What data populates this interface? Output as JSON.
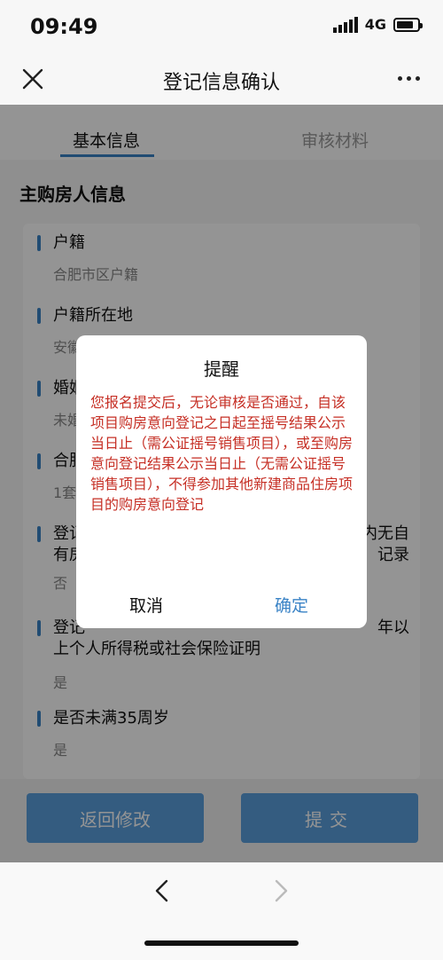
{
  "status_bar": {
    "time": "09:49",
    "network": "4G"
  },
  "header": {
    "title": "登记信息确认"
  },
  "tabs": [
    {
      "label": "基本信息",
      "active": true
    },
    {
      "label": "审核材料",
      "active": false
    }
  ],
  "section": {
    "title": "主购房人信息"
  },
  "fields": [
    {
      "label": "户籍",
      "value": "合肥市区户籍"
    },
    {
      "label": "户籍所在地",
      "value": "安徽"
    },
    {
      "label": "婚姻",
      "value": "未婚"
    },
    {
      "label": "合肥",
      "value": "1套"
    },
    {
      "label": "登记",
      "label_right": "内无自",
      "label_line2": "有房",
      "label_line2_right": "记录",
      "value": "否"
    },
    {
      "label": "登记",
      "label_right": "年以",
      "label_line2": "上个人所得税或社会保险证明",
      "value": "是"
    },
    {
      "label": "是否未满35周岁",
      "value": "是"
    }
  ],
  "buttons": {
    "back": "返回修改",
    "submit": "提交"
  },
  "dialog": {
    "title": "提醒",
    "message": "您报名提交后，无论审核是否通过，自该项目购房意向登记之日起至摇号结果公示当日止（需公证摇号销售项目），或至购房意向登记结果公示当日止（无需公证摇号销售项目），不得参加其他新建商品住房项目的购房意向登记",
    "cancel": "取消",
    "confirm": "确定"
  },
  "colors": {
    "accent": "#3a83c6",
    "button": "#5a9fdc",
    "warning_text": "#c62f25"
  }
}
